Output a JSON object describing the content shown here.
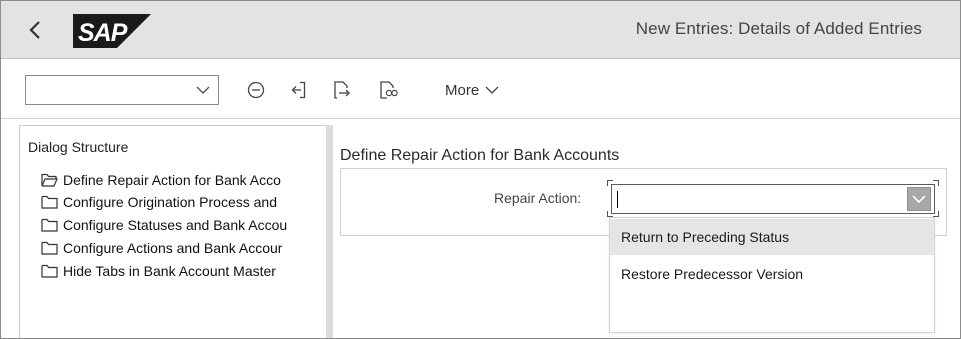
{
  "header": {
    "title": "New Entries: Details of Added Entries",
    "logo_text": "SAP",
    "logo_color": "#1a1a1a"
  },
  "toolbar": {
    "command_field_value": "",
    "icons": [
      "dropdown-chevron-icon",
      "minus-circle-icon",
      "exit-icon",
      "export-icon",
      "search-document-icon"
    ],
    "more_label": "More"
  },
  "dialog_structure": {
    "title": "Dialog Structure",
    "items": [
      {
        "label": "Define Repair Action for Bank Acco",
        "icon": "folder-open-icon",
        "selected": true
      },
      {
        "label": "Configure Origination Process and",
        "icon": "folder-icon"
      },
      {
        "label": "Configure Statuses and Bank Accou",
        "icon": "folder-icon"
      },
      {
        "label": "Configure Actions and Bank Accour",
        "icon": "folder-icon"
      },
      {
        "label": "Hide Tabs in Bank Account Master",
        "icon": "folder-icon"
      }
    ]
  },
  "main": {
    "section_title": "Define Repair Action for Bank Accounts",
    "repair_action": {
      "label": "Repair Action:",
      "value": "",
      "options": [
        {
          "label": "Return to Preceding Status",
          "highlighted": true
        },
        {
          "label": "Restore Predecessor Version"
        }
      ]
    }
  },
  "colors": {
    "header_bg": "#e3e3e3",
    "highlight_bg": "#e5e5e5",
    "dropdown_button_bg": "#a8a8a8"
  }
}
